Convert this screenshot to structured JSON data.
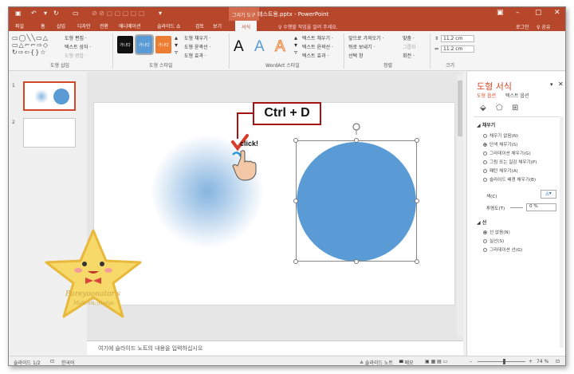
{
  "title_bar": {
    "context_tab": "그리기 도구",
    "doc_title": "테스트용.pptx - PowerPoint"
  },
  "tabs": [
    "파일",
    "홈",
    "삽입",
    "디자인",
    "전환",
    "애니메이션",
    "슬라이드 쇼",
    "검토",
    "보기",
    "서식"
  ],
  "active_tab": "서식",
  "tell_me": "♀ 수행할 작업을 알려 주세요.",
  "account": {
    "login": "로그인",
    "share": "♀ 공유"
  },
  "ribbon": {
    "insert_shapes": {
      "edit_shape": "도형 편집 ·",
      "text_box": "텍스트 상자 ·",
      "merge": "도형 병합 ·",
      "label": "도형 삽입"
    },
    "shape_styles": {
      "swatch_text": "가나다",
      "fill": "도형 채우기 ·",
      "outline": "도형 윤곽선 ·",
      "effects": "도형 효과 ·",
      "label": "도형 스타일"
    },
    "wordart": {
      "letter": "A",
      "text_fill": "텍스트 채우기 ·",
      "text_outline": "텍스트 윤곽선 ·",
      "text_effects": "텍스트 효과 ·",
      "label": "WordArt 스타일"
    },
    "arrange": {
      "bring_forward": "앞으로 가져오기 ·",
      "send_backward": "뒤로 보내기 ·",
      "selection_pane": "선택 창",
      "align": "맞춤 ·",
      "group": "그룹화 ·",
      "rotate": "회전 ·",
      "label": "정렬"
    },
    "size": {
      "height": "11.2 cm",
      "width": "11.2 cm",
      "label": "크기"
    }
  },
  "thumbnails": [
    {
      "num": "1"
    },
    {
      "num": "2"
    }
  ],
  "slide": {
    "callout_text": "Ctrl + D",
    "click_text": "click!"
  },
  "notes_placeholder": "여기에 슬라이드 노트의 내용을 입력하십시오",
  "format_pane": {
    "title": "도형 서식",
    "tab_shape": "도형 옵션",
    "tab_text": "텍스트 옵션",
    "fill_section": "◢ 채우기",
    "fill_options": [
      {
        "label": "채우기 없음(N)",
        "selected": false
      },
      {
        "label": "단색 채우기(S)",
        "selected": true
      },
      {
        "label": "그라데이션 채우기(G)",
        "selected": false
      },
      {
        "label": "그림 또는 질감 채우기(P)",
        "selected": false
      },
      {
        "label": "패턴 채우기(A)",
        "selected": false
      },
      {
        "label": "슬라이드 배경 채우기(B)",
        "selected": false
      }
    ],
    "color_label": "색(C)",
    "transparency_label": "투명도(T)",
    "transparency_value": "0 %",
    "line_section": "◢ 선",
    "line_options": [
      {
        "label": "선 없음(N)",
        "selected": true
      },
      {
        "label": "실선(S)",
        "selected": false
      },
      {
        "label": "그라데이션 선(G)",
        "selected": false
      }
    ]
  },
  "status_bar": {
    "slide_count": "슬라이드 1/2",
    "language": "한국어",
    "notes_btn": "≙ 슬라이드 노트",
    "comments_btn": "▀ 메모",
    "zoom": "74 %"
  },
  "colors": {
    "accent": "#b7472a",
    "shape_blue": "#5b9bd5",
    "callout_border": "#a31515"
  }
}
